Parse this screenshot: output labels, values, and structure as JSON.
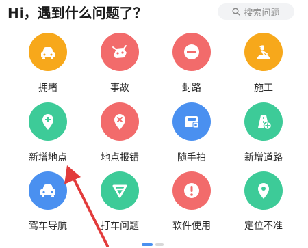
{
  "header": {
    "title": "Hi，遇到什么问题了？",
    "search_placeholder": "搜索问题",
    "search_icon": "search-icon"
  },
  "tiles": [
    {
      "label": "拥堵",
      "icon": "congestion-car-icon",
      "color": "#F7A81B"
    },
    {
      "label": "事故",
      "icon": "accident-car-icon",
      "color": "#F26B6B"
    },
    {
      "label": "封路",
      "icon": "road-closed-icon",
      "color": "#F26B6B"
    },
    {
      "label": "施工",
      "icon": "construction-worker-icon",
      "color": "#F7A81B"
    },
    {
      "label": "新增地点",
      "icon": "add-location-icon",
      "color": "#3DCB98"
    },
    {
      "label": "地点报错",
      "icon": "location-error-icon",
      "color": "#F26B6B"
    },
    {
      "label": "随手拍",
      "icon": "photo-truck-icon",
      "color": "#4A90F0"
    },
    {
      "label": "新增道路",
      "icon": "add-road-icon",
      "color": "#3DCB98"
    },
    {
      "label": "驾车导航",
      "icon": "car-navigation-icon",
      "color": "#4A90F0"
    },
    {
      "label": "打车问题",
      "icon": "taxi-problem-icon",
      "color": "#3DCB98"
    },
    {
      "label": "软件使用",
      "icon": "app-usage-alert-icon",
      "color": "#F26B6B"
    },
    {
      "label": "定位不准",
      "icon": "location-inaccurate-icon",
      "color": "#3DCB98"
    }
  ],
  "colors": {
    "annotation_arrow": "#E23B3B",
    "page_indicator_active": "#4A90F0",
    "page_indicator_inactive": "#D8D8D8"
  }
}
